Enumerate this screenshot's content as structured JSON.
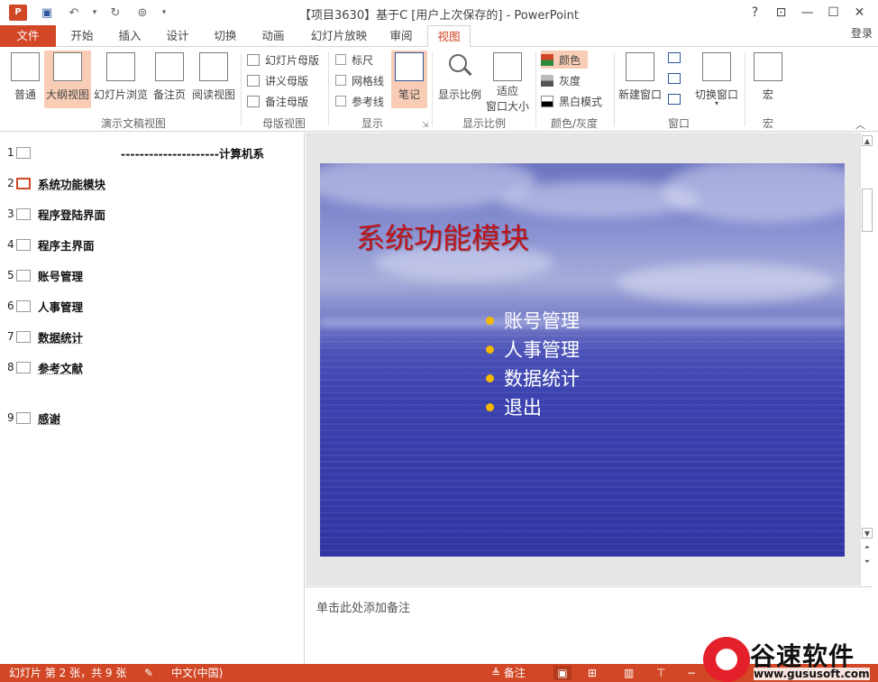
{
  "window": {
    "title": "【项目3630】基于C [用户上次保存的] - PowerPoint",
    "app_logo": "P",
    "help": "?",
    "restore_ribbon": "⊡",
    "minimize": "—",
    "maximize": "☐",
    "close": "✕"
  },
  "qat": {
    "save": "▣",
    "undo": "↶",
    "undo_drop": "▾",
    "redo": "↻",
    "present": "⊚",
    "customize": "▾"
  },
  "tabs": [
    "文件",
    "开始",
    "插入",
    "设计",
    "切换",
    "动画",
    "幻灯片放映",
    "审阅",
    "视图"
  ],
  "login": "登录",
  "ribbon": {
    "presentation_views": {
      "group": "演示文稿视图",
      "buttons": [
        "普通",
        "大纲视图",
        "幻灯片浏览",
        "备注页",
        "阅读视图"
      ]
    },
    "master_views": {
      "group": "母版视图",
      "items": [
        "幻灯片母版",
        "讲义母版",
        "备注母版"
      ]
    },
    "show": {
      "group": "显示",
      "checks": [
        "标尺",
        "网格线",
        "参考线"
      ],
      "notes": "笔记"
    },
    "zoom": {
      "group": "显示比例",
      "zoom": "显示比例",
      "fit_line1": "适应",
      "fit_line2": "窗口大小"
    },
    "color": {
      "group": "颜色/灰度",
      "items": [
        "颜色",
        "灰度",
        "黑白模式"
      ]
    },
    "window": {
      "group": "窗口",
      "new_window": "新建窗口",
      "switch": "切换窗口"
    },
    "macros": {
      "group": "宏",
      "label": "宏"
    }
  },
  "outline": [
    {
      "num": "1",
      "title": "---------------------计算机系"
    },
    {
      "num": "2",
      "title": "系统功能模块"
    },
    {
      "num": "3",
      "title": "程序登陆界面"
    },
    {
      "num": "4",
      "title": "程序主界面"
    },
    {
      "num": "5",
      "title": "账号管理"
    },
    {
      "num": "6",
      "title": "人事管理"
    },
    {
      "num": "7",
      "title": "数据统计"
    },
    {
      "num": "8",
      "title": "参考文献"
    },
    {
      "num": "9",
      "title": "感谢"
    }
  ],
  "slide": {
    "title": "系统功能模块",
    "bullets": [
      "账号管理",
      "人事管理",
      "数据统计",
      "退出"
    ],
    "title_color": "#c0141a",
    "bullet_color": "#f5b800"
  },
  "notes_placeholder": "单击此处添加备注",
  "status": {
    "slide_info": "幻灯片 第 2 张，共 9 张",
    "language": "中文(中国)",
    "notes": "备注",
    "zoom": "%"
  },
  "watermark": {
    "name": "谷速软件",
    "url": "www.gususoft.com"
  },
  "colors": {
    "accent": "#d24726",
    "ribbon_selected": "#f9cdb5"
  }
}
